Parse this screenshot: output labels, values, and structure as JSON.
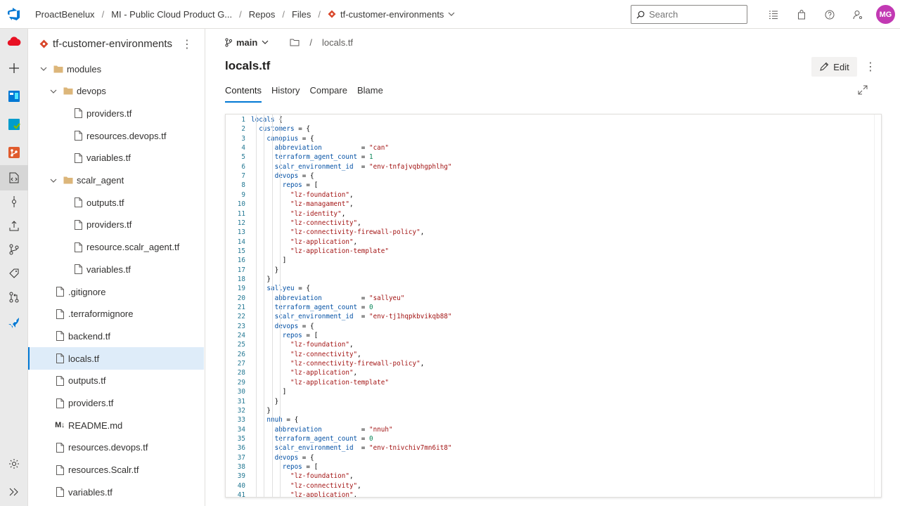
{
  "topbar": {
    "org": "ProactBenelux",
    "project": "MI - Public Cloud Product G...",
    "section": "Repos",
    "subsection": "Files",
    "repo": "tf-customer-environments",
    "search_placeholder": "Search",
    "avatar_initials": "MG",
    "avatar_color": "#c239b3"
  },
  "tree": {
    "repo_name": "tf-customer-environments",
    "nodes": [
      {
        "label": "modules",
        "kind": "folder",
        "depth": 0,
        "expanded": true
      },
      {
        "label": "devops",
        "kind": "folder",
        "depth": 1,
        "expanded": true
      },
      {
        "label": "providers.tf",
        "kind": "file",
        "depth": 2
      },
      {
        "label": "resources.devops.tf",
        "kind": "file",
        "depth": 2
      },
      {
        "label": "variables.tf",
        "kind": "file",
        "depth": 2
      },
      {
        "label": "scalr_agent",
        "kind": "folder",
        "depth": 1,
        "expanded": true
      },
      {
        "label": "outputs.tf",
        "kind": "file",
        "depth": 2
      },
      {
        "label": "providers.tf",
        "kind": "file",
        "depth": 2
      },
      {
        "label": "resource.scalr_agent.tf",
        "kind": "file",
        "depth": 2
      },
      {
        "label": "variables.tf",
        "kind": "file",
        "depth": 2
      },
      {
        "label": ".gitignore",
        "kind": "file",
        "depth": 0
      },
      {
        "label": ".terraformignore",
        "kind": "file",
        "depth": 0
      },
      {
        "label": "backend.tf",
        "kind": "file",
        "depth": 0
      },
      {
        "label": "locals.tf",
        "kind": "file",
        "depth": 0,
        "selected": true
      },
      {
        "label": "outputs.tf",
        "kind": "file",
        "depth": 0
      },
      {
        "label": "providers.tf",
        "kind": "file",
        "depth": 0
      },
      {
        "label": "README.md",
        "kind": "markdown",
        "depth": 0
      },
      {
        "label": "resources.devops.tf",
        "kind": "file",
        "depth": 0
      },
      {
        "label": "resources.Scalr.tf",
        "kind": "file",
        "depth": 0
      },
      {
        "label": "variables.tf",
        "kind": "file",
        "depth": 0
      }
    ]
  },
  "main": {
    "branch": "main",
    "path_file": "locals.tf",
    "file_title": "locals.tf",
    "edit_label": "Edit",
    "tabs": [
      "Contents",
      "History",
      "Compare",
      "Blame"
    ],
    "active_tab": "Contents"
  },
  "code": {
    "lines": [
      "locals {",
      "  customers = {",
      "    canopius = {",
      "      abbreviation          = \"can\"",
      "      terraform_agent_count = 1",
      "      scalr_environment_id  = \"env-tnfajvqbhgphlhg\"",
      "      devops = {",
      "        repos = [",
      "          \"lz-foundation\",",
      "          \"lz-managament\",",
      "          \"lz-identity\",",
      "          \"lz-connectivity\",",
      "          \"lz-connectivity-firewall-policy\",",
      "          \"lz-application\",",
      "          \"lz-application-template\"",
      "        ]",
      "      }",
      "    }",
      "    sallyeu = {",
      "      abbreviation          = \"sallyeu\"",
      "      terraform_agent_count = 0",
      "      scalr_environment_id  = \"env-tj1hqpkbvikqb88\"",
      "      devops = {",
      "        repos = [",
      "          \"lz-foundation\",",
      "          \"lz-connectivity\",",
      "          \"lz-connectivity-firewall-policy\",",
      "          \"lz-application\",",
      "          \"lz-application-template\"",
      "        ]",
      "      }",
      "    }",
      "    nnuh = {",
      "      abbreviation          = \"nnuh\"",
      "      terraform_agent_count = 0",
      "      scalr_environment_id  = \"env-tnivchiv7mn6it8\"",
      "      devops = {",
      "        repos = [",
      "          \"lz-foundation\",",
      "          \"lz-connectivity\",",
      "          \"lz-application\","
    ]
  }
}
